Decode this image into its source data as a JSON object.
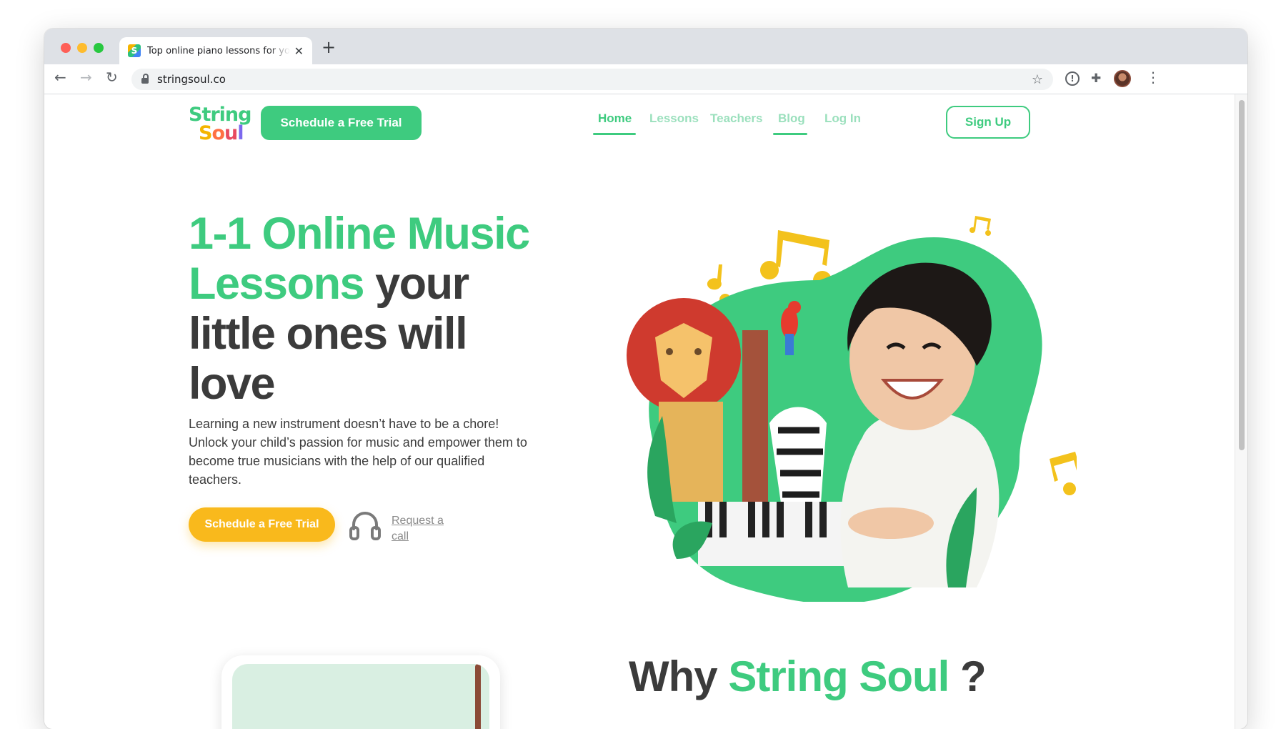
{
  "browser": {
    "tab_title": "Top online piano lessons for your kids",
    "url": "stringsoul.co"
  },
  "site": {
    "logo_line1": "String",
    "logo_line2": "Soul",
    "header_trial_button": "Schedule a Free Trial",
    "nav": [
      {
        "label": "Home",
        "active": true
      },
      {
        "label": "Lessons",
        "active": false
      },
      {
        "label": "Teachers",
        "active": false
      },
      {
        "label": "Blog",
        "active": false
      },
      {
        "label": "Log In",
        "active": false
      }
    ],
    "signup_button": "Sign Up"
  },
  "hero": {
    "title_green": "1-1 Online Music Lessons",
    "title_dark": "your little ones will love",
    "description": "Learning a new instrument doesn’t have to be a chore! Unlock your child’s passion for music and empower them to become true musicians with the help of our qualified teachers.",
    "trial_button": "Schedule a Free Trial",
    "request_call": "Request a call"
  },
  "why": {
    "prefix": "Why",
    "brand": "String Soul",
    "suffix": "?"
  },
  "colors": {
    "brand_green": "#3ecb7f",
    "accent_yellow": "#f9b91c",
    "text_dark": "#3b3b3b"
  }
}
